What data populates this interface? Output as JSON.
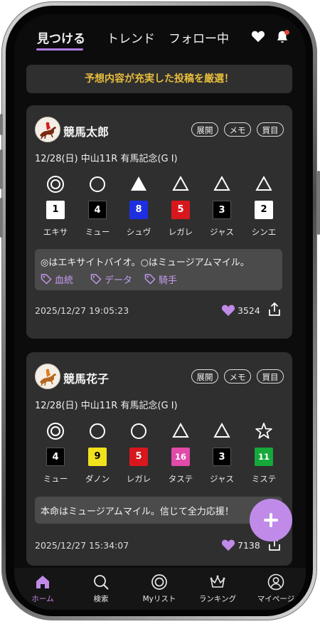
{
  "header": {
    "tabs": [
      {
        "label": "見つける",
        "active": true
      },
      {
        "label": "トレンド",
        "active": false
      },
      {
        "label": "フォロー中",
        "active": false
      }
    ],
    "icons": [
      "heart-icon",
      "bell-icon"
    ]
  },
  "banner": {
    "text": "予想内容が充実した投稿を厳選！"
  },
  "posts": [
    {
      "author": "競馬太郎",
      "buttons": [
        "展開",
        "メモ",
        "買目"
      ],
      "race": "12/28(日)  中山11R  有馬記念(G I)",
      "picks": [
        {
          "mark": "◎",
          "number": "1",
          "name": "エキサ",
          "box_color": "#ffffff",
          "num_color": "#000000"
        },
        {
          "mark": "○",
          "number": "4",
          "name": "ミュー",
          "box_color": "#000000",
          "num_color": "#ffffff"
        },
        {
          "mark": "▲",
          "number": "8",
          "name": "シュヴ",
          "box_color": "#1d2fe0",
          "num_color": "#ffffff"
        },
        {
          "mark": "△",
          "number": "5",
          "name": "レガレ",
          "box_color": "#d8171d",
          "num_color": "#ffffff"
        },
        {
          "mark": "△",
          "number": "3",
          "name": "ジャス",
          "box_color": "#000000",
          "num_color": "#ffffff"
        },
        {
          "mark": "△",
          "number": "2",
          "name": "シンエ",
          "box_color": "#ffffff",
          "num_color": "#000000"
        }
      ],
      "comment": "◎はエキサイトバイオ。○はミュージアムマイル。",
      "tags": [
        "血統",
        "データ",
        "騎手"
      ],
      "timestamp": "2025/12/27 19:05:23",
      "likes": "3524"
    },
    {
      "author": "競馬花子",
      "buttons": [
        "展開",
        "メモ",
        "買目"
      ],
      "race": "12/28(日)  中山11R  有馬記念(G I)",
      "picks": [
        {
          "mark": "◎",
          "number": "4",
          "name": "ミュー",
          "box_color": "#000000",
          "num_color": "#ffffff"
        },
        {
          "mark": "○",
          "number": "9",
          "name": "ダノン",
          "box_color": "#f1e21c",
          "num_color": "#000000"
        },
        {
          "mark": "○",
          "number": "5",
          "name": "レガレ",
          "box_color": "#d8171d",
          "num_color": "#ffffff"
        },
        {
          "mark": "△",
          "number": "16",
          "name": "タステ",
          "box_color": "#e04aa8",
          "num_color": "#ffffff"
        },
        {
          "mark": "△",
          "number": "3",
          "name": "ジャス",
          "box_color": "#000000",
          "num_color": "#ffffff"
        },
        {
          "mark": "☆",
          "number": "11",
          "name": "ミステ",
          "box_color": "#16a83a",
          "num_color": "#ffffff"
        }
      ],
      "comment": "本命はミュージアムマイル。信じて全力応援！",
      "tags": [],
      "timestamp": "2025/12/27 15:34:07",
      "likes": "7138"
    }
  ],
  "fab": {
    "icon": "plus-icon"
  },
  "bottom_nav": [
    {
      "label": "ホーム",
      "icon": "home-icon",
      "active": true
    },
    {
      "label": "検索",
      "icon": "search-icon",
      "active": false
    },
    {
      "label": "Myリスト",
      "icon": "target-icon",
      "active": false
    },
    {
      "label": "ランキング",
      "icon": "crown-icon",
      "active": false
    },
    {
      "label": "マイページ",
      "icon": "user-icon",
      "active": false
    }
  ],
  "colors": {
    "accent": "#c08be8",
    "banner_text": "#e7bd3c",
    "card": "#2f2f2f",
    "background": "#0c0c0c"
  }
}
